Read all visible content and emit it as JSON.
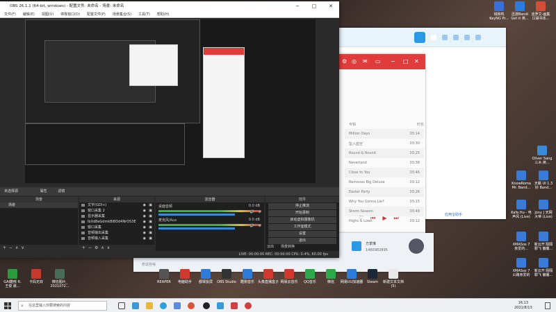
{
  "obs": {
    "title": "OBS 26.1.1 (64-bit, windows) - 配置文件: 未命名 - 场景: 未命名",
    "menu": [
      "文件(F)",
      "编辑(E)",
      "视图(V)",
      "停靠窗口(D)",
      "配置文件(P)",
      "场景集合(S)",
      "工具(T)",
      "帮助(H)"
    ],
    "scene_bar": "未选择源",
    "props_label": "属性",
    "filter_label": "滤镜",
    "docks": {
      "scenes_header": "场景",
      "scenes": [
        "场景"
      ],
      "sources_header": "来源",
      "sources": [
        "文字(GDI+)",
        "窗口采集 2",
        "显示器采集",
        "lbXd8eGdmkBl8Dd4NrOS3Ew",
        "窗口采集",
        "音频输出采集",
        "音频输入采集"
      ],
      "mixer_header": "混音器",
      "mixer": [
        {
          "name": "桌面音频",
          "db": "0.0 dB"
        },
        {
          "name": "麦克风/Aux",
          "db": "0.0 dB"
        }
      ],
      "controls_header": "控件",
      "controls": [
        "停止推流",
        "开始录制",
        "启动虚拟摄像机",
        "工作室模式",
        "设置",
        "退出"
      ],
      "transition_labels": [
        "淡出",
        "场景转换"
      ]
    },
    "status": "LIVE: 00:00:00   REC: 00:00:00   CPU: 0.4%, 60.00 fps"
  },
  "music": {
    "songs_header": {
      "title": "专辑",
      "time": "时长"
    },
    "songs": [
      {
        "title": "Million Days",
        "time": "03:14"
      },
      {
        "title": "坠入蓝空",
        "time": "03:30"
      },
      {
        "title": "Round & Round",
        "time": "03:25"
      },
      {
        "title": "Neverland",
        "time": "03:38"
      },
      {
        "title": "Close to You",
        "time": "03:46"
      },
      {
        "title": "Removes Big Deluxe",
        "time": "03:12"
      },
      {
        "title": "Easter Party",
        "time": "03:26"
      },
      {
        "title": "Why You Gonna Lie?",
        "time": "03:15"
      },
      {
        "title": "Storm Season",
        "time": "03:49"
      },
      {
        "title": "Highs & Lows",
        "time": "03:12"
      }
    ],
    "artist_line": "方季惟",
    "id_line": "1460982895",
    "app_label": "应用宝助手"
  },
  "chat": {
    "placeholder": "想说些啥"
  },
  "desktop_icons_right": [
    {
      "label": "钱和鸣\nKeyNG Pr...",
      "color": "#3a6fd8"
    },
    {
      "label": "迅游Bandi\nGet it 英...",
      "color": "#2b7be0"
    },
    {
      "label": "迪罗艾-画集\n口袋书本...",
      "color": "#d24e38"
    },
    {
      "label": "Oliver Sang\n三木.英...",
      "color": "#3a8ad8"
    },
    {
      "label": "KnowRoma\nMr. Band...",
      "color": "#3a7bd8"
    },
    {
      "label": "天籁 UI 1.3\n好 Band...",
      "color": "#3a7bd8"
    },
    {
      "label": "Kafe.Hu - 电\n声风 (Live)",
      "color": "#3a7bd8"
    },
    {
      "label": "Jony J 天网\n大帝 (Live)",
      "color": "#3a7bd8"
    },
    {
      "label": "XMASos 7\n亲爱的...",
      "color": "#3a7bd8"
    },
    {
      "label": "新云开 阻隔\n罪飞 偏偏...",
      "color": "#3a7bd8"
    },
    {
      "label": "XMASos 7\n公路亲爱的",
      "color": "#3a7bd8"
    },
    {
      "label": "新云开 阻隔\n罪飞 偏偏...",
      "color": "#3a7bd8"
    }
  ],
  "desktop_icons_bottom_left": [
    {
      "label": "GAI酷咳 ft.\n王俊 晨...",
      "color": "#2c9a3c"
    },
    {
      "label": "卡妈无双",
      "color": "#c63a2e"
    },
    {
      "label": "微信图片_\n2021072...",
      "color": "#4a6a5a"
    }
  ],
  "dock_bar": [
    {
      "label": "REAPER",
      "color": "#555"
    },
    {
      "label": "电脑助手",
      "color": "#d03a2e"
    },
    {
      "label": "都铎投屏",
      "color": "#2e7bd8"
    },
    {
      "label": "OBS Studio",
      "color": "#333"
    },
    {
      "label": "酷狗音乐",
      "color": "#2e7bd8"
    },
    {
      "label": "头像直播盒子",
      "color": "#d03a2e"
    },
    {
      "label": "网易云音乐",
      "color": "#d03a2e"
    },
    {
      "label": "QQ音乐",
      "color": "#2ea84a"
    },
    {
      "label": "微信",
      "color": "#2ea84a"
    },
    {
      "label": "网易UU加速器",
      "color": "#2e7bd8"
    },
    {
      "label": "Steam",
      "color": "#1b2838"
    },
    {
      "label": "新建文本文档\n(5)",
      "color": "#e8e8e8"
    }
  ],
  "taskbar": {
    "search_placeholder": "在这里输入你要搜索的内容",
    "time": "16:13",
    "date": "2021/8/13"
  }
}
